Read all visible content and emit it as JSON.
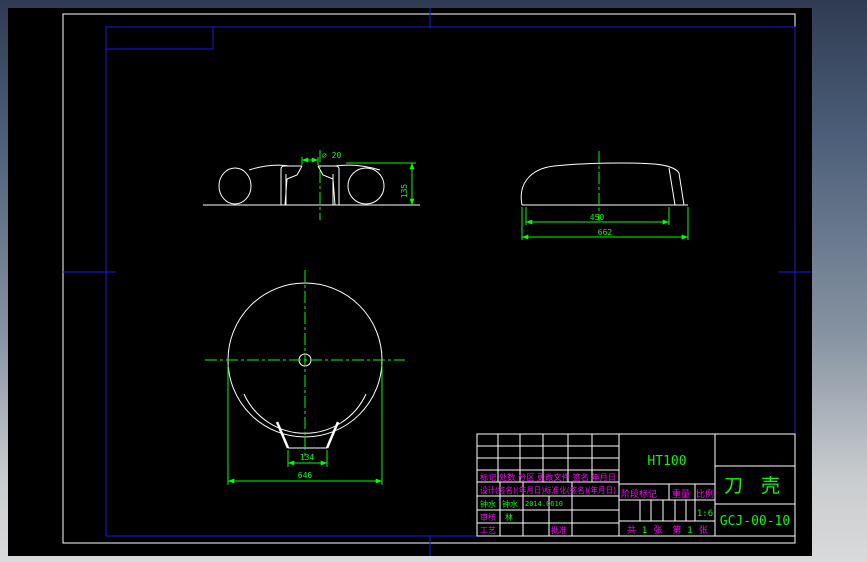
{
  "colors": {
    "canvas_background": "#000000",
    "outline_lines": "#ffffff",
    "dimension_lines": "#00ff00",
    "template_labels": "#ff00ff",
    "sheet_border": "#1818e6"
  },
  "views": {
    "front": {
      "dim_diameter": "⌀ 20",
      "dim_height": "135"
    },
    "side": {
      "dim_inner": "450",
      "dim_outer": "662"
    },
    "bottom": {
      "dim_inner": "134",
      "dim_outer": "646"
    }
  },
  "title_block": {
    "material": "HT100",
    "part_name": "刀 壳",
    "drawing_number": "GCJ-00-10",
    "revision_header": "标记 处数 分区 更改文件 签名 年月日",
    "design_header": "设计(签名)(年月日)标准化(签名)(年月日)",
    "stage_label": "阶段标记",
    "weight_label": "重量",
    "scale_label": "比例",
    "scale_value": "1:6",
    "sheet_total_label": "共",
    "sheet_total": "1",
    "sheet_unit1": "张",
    "sheet_index_label": "第",
    "sheet_index": "1",
    "sheet_unit2": "张",
    "sign_name1": "钟水",
    "sign_name2": "钟水",
    "sign_date": "2014.0610",
    "review_label": "审核",
    "review_name": "林",
    "process_label": "工艺",
    "approve_label": "批准"
  }
}
